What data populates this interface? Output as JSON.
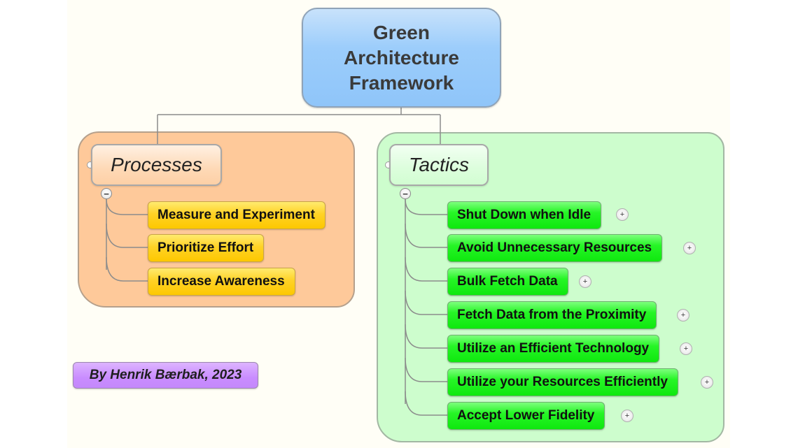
{
  "diagram": {
    "type": "mind-map",
    "root": {
      "title_lines": [
        "Green",
        "Architecture",
        "Framework"
      ],
      "color": "#9ccdfb"
    },
    "branches": [
      {
        "label": "Processes",
        "region_color": "#fec99a",
        "child_color": "#ffd226",
        "collapse_icon": "minus",
        "children": [
          {
            "label": "Measure and Experiment",
            "has_expand": false
          },
          {
            "label": "Prioritize Effort",
            "has_expand": false
          },
          {
            "label": "Increase Awareness",
            "has_expand": false
          }
        ]
      },
      {
        "label": "Tactics",
        "region_color": "#cdfdcd",
        "child_color": "#26f526",
        "collapse_icon": "minus",
        "children": [
          {
            "label": "Shut Down when Idle",
            "has_expand": true
          },
          {
            "label": "Avoid Unnecessary Resources",
            "has_expand": true
          },
          {
            "label": "Bulk Fetch Data",
            "has_expand": true
          },
          {
            "label": "Fetch Data from the Proximity",
            "has_expand": true
          },
          {
            "label": "Utilize an Efficient Technology",
            "has_expand": true
          },
          {
            "label": "Utilize your Resources Efficiently",
            "has_expand": true
          },
          {
            "label": "Accept Lower Fidelity",
            "has_expand": true
          }
        ]
      }
    ],
    "credit": {
      "label": "By Henrik Bærbak, 2023",
      "color": "#c98cff"
    },
    "icons": {
      "collapse": "−",
      "expand": "+"
    }
  }
}
